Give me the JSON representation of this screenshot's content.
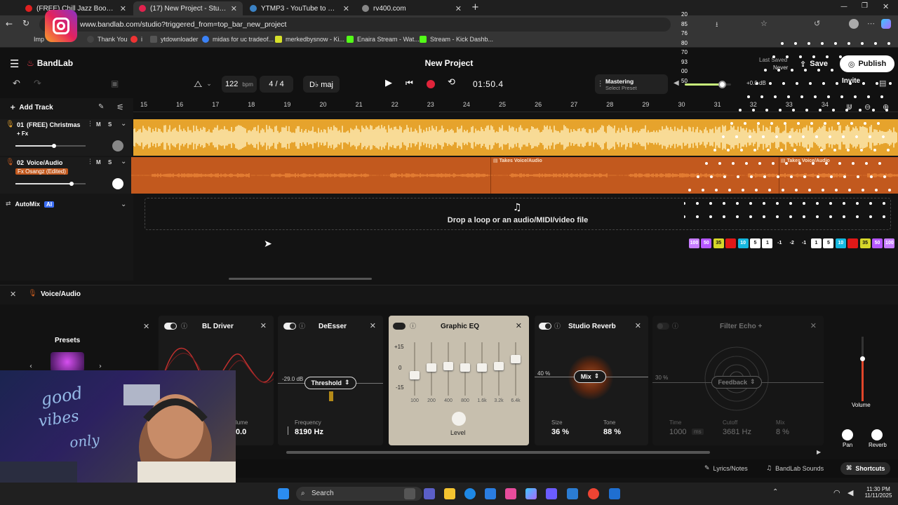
{
  "browser": {
    "tabs": [
      {
        "title": "(FREE) Chill Jazz Boom Bap Type",
        "color": "#e02020"
      },
      {
        "title": "(17) New Project - Studio",
        "color": "#e0224e"
      },
      {
        "title": "YTMP3 - YouTube to MP3 Conve",
        "color": "#3b82c4"
      },
      {
        "title": "rv400.com",
        "color": "#888888"
      }
    ],
    "url": "www.bandlab.com/studio?triggered_from=top_bar_new_project",
    "bookmarks": [
      "Imp",
      "Thank You",
      "i",
      "ytdownloader",
      "midas for uc tradeof...",
      "merkedbysnow - Ki...",
      "Enaira Stream - Wat...",
      "Stream - Kick Dashb..."
    ]
  },
  "app": {
    "brand": "BandLab",
    "project_title": "New Project",
    "last_saved_label": "Last Saved",
    "last_saved_value": "Never",
    "save_label": "Save",
    "publish_label": "Publish",
    "invite_label": "Invite",
    "tempo": "122",
    "tempo_unit": "bpm",
    "time_signature": "4 / 4",
    "key": "D♭ maj",
    "time": "01:50.4",
    "mastering_label": "Mastering",
    "mastering_preset": "Select Preset",
    "volume_db": "+0.0 dB",
    "volume_level": 0.8
  },
  "ruler": [
    "15",
    "16",
    "17",
    "18",
    "19",
    "20",
    "21",
    "22",
    "23",
    "24",
    "25",
    "26",
    "27",
    "28",
    "29",
    "30",
    "31",
    "32",
    "33",
    "34"
  ],
  "tracks": [
    {
      "index": "01",
      "name": "(FREE) Christmas T...",
      "sub": "+ Fx",
      "m": "M",
      "s": "S",
      "color": "#e6a32c",
      "vol": 0.55
    },
    {
      "index": "02",
      "name": "Voice/Audio",
      "sub": "Fx Osangz (Edited)",
      "m": "M",
      "s": "S",
      "color": "#c2591e",
      "vol": 0.8
    }
  ],
  "takes_label": "Takes",
  "takes_clip": "Voice/Audio",
  "add_track_label": "Add Track",
  "automix_label": "AutoMix",
  "automix_badge": "AI",
  "drop_label": "Drop a loop or an audio/MIDI/video file",
  "fx": {
    "track_label": "Voice/Audio",
    "presets_label": "Presets",
    "bl_driver": {
      "title": "BL Driver",
      "vol_label": "lume",
      "vol_value": "0.0"
    },
    "deesser": {
      "title": "DeEsser",
      "threshold_label": "Threshold",
      "db": "-29.0 dB",
      "freq_label": "Frequency",
      "freq_value": "8190 Hz"
    },
    "geq": {
      "title": "Graphic EQ",
      "scale": [
        "+15",
        "0",
        "-15"
      ],
      "bands": [
        "100",
        "200",
        "400",
        "800",
        "1.6k",
        "3.2k",
        "6.4k"
      ],
      "level_label": "Level"
    },
    "reverb": {
      "title": "Studio Reverb",
      "mix_label": "Mix",
      "mix_pct": "40 %",
      "size_label": "Size",
      "size_value": "36 %",
      "tone_label": "Tone",
      "tone_value": "88 %"
    },
    "echo": {
      "title": "Filter Echo +",
      "feedback_label": "Feedback",
      "fb_pct": "30 %",
      "time_label": "Time",
      "time_value": "1000",
      "time_unit": "ms",
      "cutoff_label": "Cutoff",
      "cutoff_value": "3681 Hz",
      "mix_label": "Mix",
      "mix_value": "8 %"
    },
    "volume_label": "Volume",
    "pan_label": "Pan",
    "reverb_label": "Reverb"
  },
  "footer": {
    "lyrics": "Lyrics/Notes",
    "sounds": "BandLab Sounds",
    "shortcuts": "Shortcuts"
  },
  "overlay_numbers": [
    "20",
    "85",
    "76",
    "80",
    "70",
    "93",
    "00",
    "50"
  ],
  "overlay_badges": [
    "100",
    "50",
    "35",
    "",
    "10",
    "5",
    "1",
    "-1",
    "-2",
    "-1",
    "1",
    "5",
    "10",
    "",
    "35",
    "50",
    "100"
  ],
  "taskbar": {
    "search": "Search",
    "time": "11:30 PM",
    "date": "11/11/2025"
  }
}
